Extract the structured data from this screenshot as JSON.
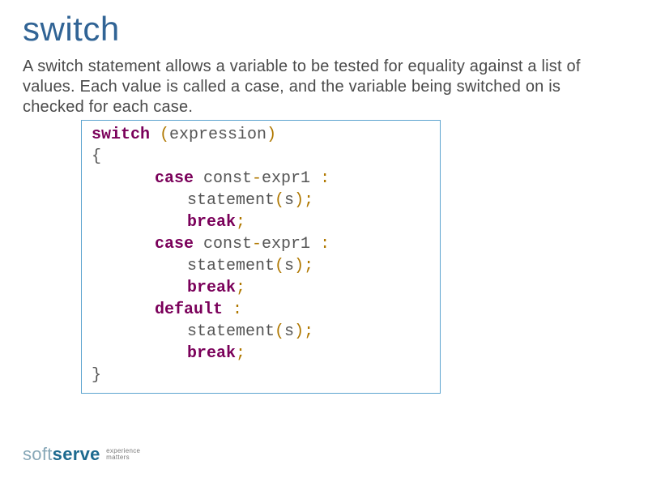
{
  "title": "switch",
  "description": "A switch statement allows a variable to be tested for equality against a list of values. Each value is called a case, and the variable being switched on is checked for each case.",
  "code": {
    "lines": [
      {
        "kw": "switch ",
        "paren": "(",
        "rest": "expression",
        "paren2": ")"
      },
      {
        "rest": "{"
      },
      {
        "indent": 1,
        "kw": "case ",
        "rest_a": "const",
        "dash": "-",
        "rest_b": "expr1 ",
        "colon": ":"
      },
      {
        "indent": 2,
        "rest_a": "statement",
        "paren": "(",
        "rest_b": "s",
        "paren2": ")",
        "semi": ";"
      },
      {
        "indent": 2,
        "kw": "break",
        "semi": ";"
      },
      {
        "indent": 1,
        "kw": "case ",
        "rest_a": "const",
        "dash": "-",
        "rest_b": "expr1 ",
        "colon": ":"
      },
      {
        "indent": 2,
        "rest_a": "statement",
        "paren": "(",
        "rest_b": "s",
        "paren2": ")",
        "semi": ";"
      },
      {
        "indent": 2,
        "kw": "break",
        "semi": ";"
      },
      {
        "indent": 1,
        "kw": "default ",
        "colon": ":"
      },
      {
        "indent": 2,
        "rest_a": "statement",
        "paren": "(",
        "rest_b": "s",
        "paren2": ")",
        "semi": ";"
      },
      {
        "indent": 2,
        "kw": "break",
        "semi": ";"
      },
      {
        "rest": "}"
      }
    ]
  },
  "logo": {
    "soft": "soft",
    "serve": "serve",
    "tag1": "experience",
    "tag2": "matters"
  }
}
